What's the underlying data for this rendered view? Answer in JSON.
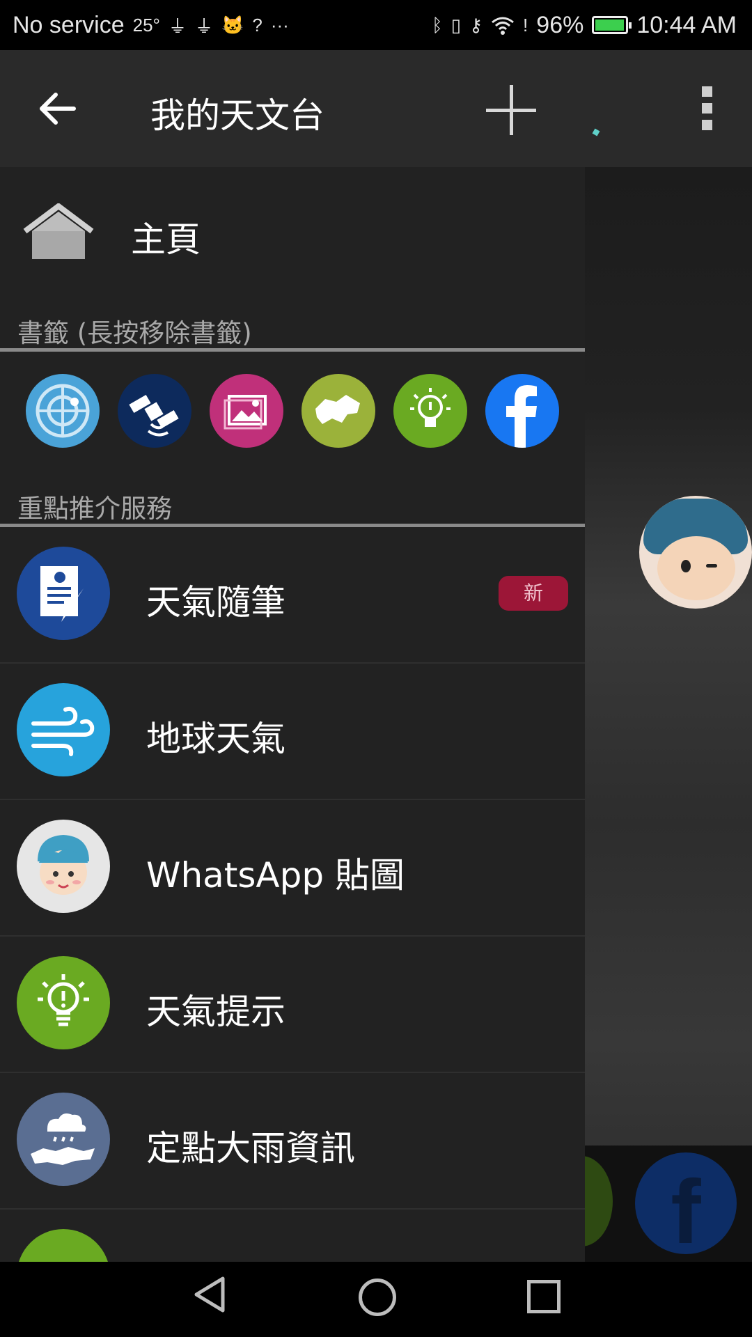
{
  "status_bar": {
    "carrier": "No service",
    "temperature": "25°",
    "battery_percent": "96%",
    "time": "10:44 AM",
    "icons": [
      "usb-icon",
      "usb-icon",
      "cat-icon",
      "wifi-question-icon",
      "more-dots-icon",
      "bluetooth-icon",
      "vibrate-icon",
      "key-icon",
      "wifi-icon",
      "battery-alert-icon",
      "battery-charging-icon"
    ]
  },
  "app_bar": {
    "title": "我的天文台",
    "back_icon": "arrow-left-icon",
    "add_icon": "plus-icon",
    "more_icon": "overflow-menu-icon"
  },
  "drawer": {
    "home_label": "主頁",
    "bookmarks_header": "書籤 (長按移除書籤)",
    "bookmarks": [
      {
        "name": "radar-icon",
        "color": "#4aa3d8"
      },
      {
        "name": "satellite-icon",
        "color": "#0d2a5c"
      },
      {
        "name": "gallery-icon",
        "color": "#c0307a"
      },
      {
        "name": "hong-kong-map-icon",
        "color": "#9bb23a"
      },
      {
        "name": "lightbulb-icon",
        "color": "#6aaa22"
      },
      {
        "name": "facebook-icon",
        "color": "#1877f2"
      }
    ],
    "featured_header": "重點推介服務",
    "services": [
      {
        "label": "天氣隨筆",
        "icon": "weather-notes-icon",
        "color": "#1e4a9a",
        "badge": "新"
      },
      {
        "label": "地球天氣",
        "icon": "wind-icon",
        "color": "#27a3dc"
      },
      {
        "label": "WhatsApp 貼圖",
        "icon": "sticker-mascot-icon",
        "color": "#e6e6e6"
      },
      {
        "label": "天氣提示",
        "icon": "lightbulb-icon",
        "color": "#6aaa22"
      },
      {
        "label": "定點大雨資訊",
        "icon": "rain-map-icon",
        "color": "#5a6e92"
      }
    ]
  },
  "nav_bar": {
    "back_icon": "nav-back-icon",
    "home_icon": "nav-home-icon",
    "recent_icon": "nav-recent-icon"
  }
}
